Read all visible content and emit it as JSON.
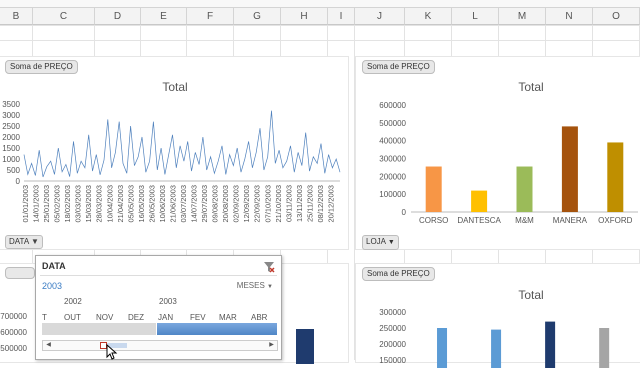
{
  "columns": [
    "B",
    "C",
    "D",
    "E",
    "F",
    "G",
    "H",
    "I",
    "J",
    "K",
    "L",
    "M",
    "N",
    "O"
  ],
  "colors": {
    "line": "#4f81bd",
    "orange": "#f79646",
    "yellow": "#ffc000",
    "green": "#9bbb59",
    "brown": "#c0504d",
    "darkbrown": "#a5530d",
    "gold": "#bf8f00",
    "light_blue": "#5b9bd5",
    "dark_blue": "#1f3b6e",
    "gray": "#a5a5a5"
  },
  "chart1": {
    "field_button": "Soma de PREÇO",
    "filter_button": "DATA",
    "chart_data": {
      "type": "line",
      "title": "Total",
      "ylim": [
        0,
        3500
      ],
      "yticks": [
        "3500",
        "3000",
        "2500",
        "2000",
        "1500",
        "1000",
        "500",
        "0"
      ],
      "xticks": [
        "01/01/2003",
        "14/01/2003",
        "25/01/2003",
        "05/02/2003",
        "18/02/2003",
        "03/03/2003",
        "15/03/2003",
        "28/03/2003",
        "10/04/2003",
        "21/04/2003",
        "05/05/2003",
        "16/05/2003",
        "26/05/2003",
        "10/06/2003",
        "21/06/2003",
        "03/07/2003",
        "14/07/2003",
        "29/07/2003",
        "09/08/2003",
        "20/08/2003",
        "02/09/2003",
        "12/09/2003",
        "22/09/2003",
        "07/10/2003",
        "21/10/2003",
        "03/11/2003",
        "13/11/2003",
        "25/11/2003",
        "08/12/2003",
        "20/12/2003"
      ],
      "series": [
        {
          "values": [
            1200,
            300,
            800,
            250,
            1400,
            180,
            650,
            900,
            300,
            1500,
            420,
            750,
            200,
            1800,
            350,
            900,
            600,
            2100,
            450,
            1200,
            280,
            950,
            2800,
            600,
            1300,
            2700,
            800,
            350,
            2500,
            700,
            1100,
            2000,
            400,
            900,
            2700,
            500,
            1500,
            300,
            1200,
            2100,
            600,
            1600,
            900,
            1800,
            450,
            1300,
            750,
            2000,
            500,
            1100,
            350,
            900,
            1600,
            300,
            1200,
            700,
            1500,
            400,
            1000,
            1800,
            600,
            1300,
            2400,
            500,
            1100,
            3200,
            800,
            1400,
            600,
            900,
            1600,
            400,
            1300,
            700,
            2200,
            450,
            1100,
            800,
            1700,
            350,
            1200,
            600,
            1000,
            400
          ]
        }
      ]
    }
  },
  "chart2": {
    "field_button": "Soma de PREÇO",
    "filter_button": "LOJA",
    "chart_data": {
      "type": "bar",
      "title": "Total",
      "categories": [
        "CORSO",
        "DANTESCA",
        "M&M",
        "MANERA",
        "OXFORD"
      ],
      "values": [
        255000,
        120000,
        255000,
        480000,
        390000
      ],
      "ylim": [
        0,
        600000
      ],
      "yticks": [
        "600000",
        "500000",
        "400000",
        "300000",
        "200000",
        "100000",
        "0"
      ]
    }
  },
  "chart3": {
    "yticks": [
      "700000",
      "600000",
      "500000"
    ]
  },
  "chart4": {
    "field_button": "Soma de PREÇO",
    "chart_data": {
      "type": "bar",
      "title": "Total",
      "values": [
        250000,
        245000,
        270000,
        250000
      ],
      "ylim": [
        150000,
        300000
      ],
      "yticks": [
        "300000",
        "250000",
        "200000",
        "150000"
      ]
    }
  },
  "timeline": {
    "title": "DATA",
    "period": "2003",
    "level": "MESES",
    "years": [
      "2002",
      "2003"
    ],
    "months": [
      "T",
      "OUT",
      "NOV",
      "DEZ",
      "JAN",
      "FEV",
      "MAR",
      "ABR"
    ]
  }
}
